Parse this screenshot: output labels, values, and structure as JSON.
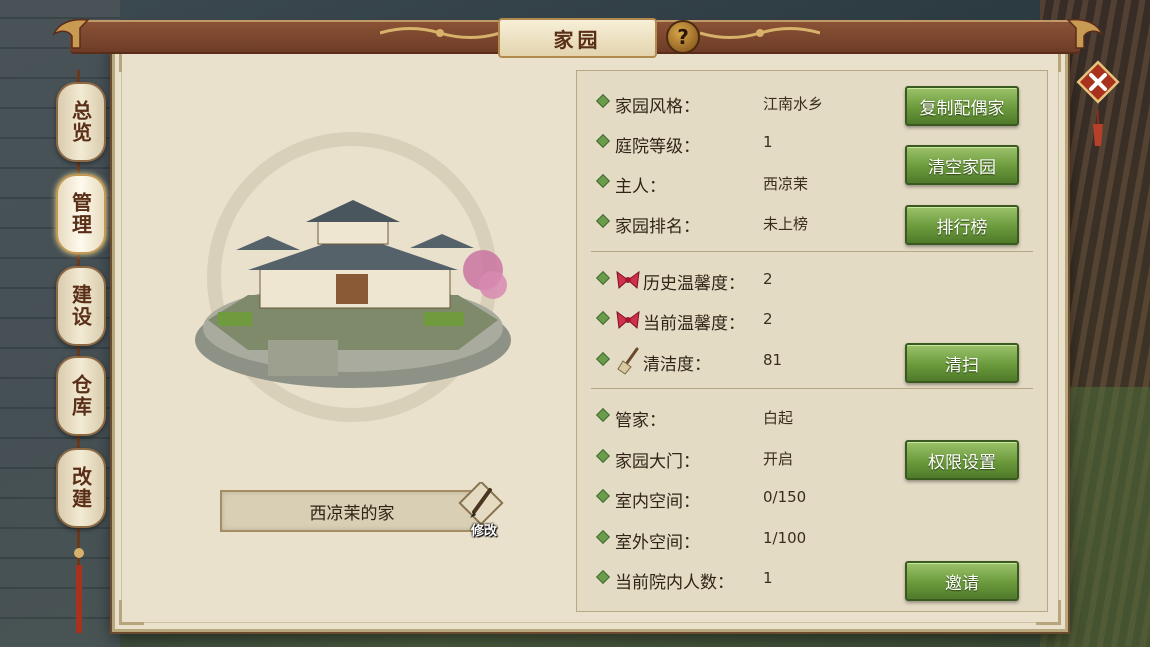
{
  "title": "家园",
  "help_icon": "?",
  "close_icon": "close-icon",
  "side_tabs": [
    {
      "label": "总览",
      "active": false
    },
    {
      "label": "管理",
      "active": true
    },
    {
      "label": "建设",
      "active": false
    },
    {
      "label": "仓库",
      "active": false
    },
    {
      "label": "改建",
      "active": false
    }
  ],
  "home_name": "西凉茉的家",
  "edit_label": "修改",
  "info": {
    "style": {
      "label": "家园风格：",
      "value": "江南水乡",
      "button": "复制配偶家"
    },
    "courtyard_level": {
      "label": "庭院等级：",
      "value": "1",
      "button": "清空家园"
    },
    "owner": {
      "label": "主人：",
      "value": "西凉茉"
    },
    "rank": {
      "label": "家园排名：",
      "value": "未上榜",
      "button": "排行榜"
    },
    "history_warmth": {
      "label": "历史温馨度：",
      "value": "2"
    },
    "current_warmth": {
      "label": "当前温馨度：",
      "value": "2"
    },
    "cleanliness": {
      "label": "清洁度：",
      "value": "81",
      "button": "清扫"
    },
    "steward": {
      "label": "管家：",
      "value": "白起"
    },
    "gate": {
      "label": "家园大门：",
      "value": "开启",
      "button": "权限设置"
    },
    "indoor_space": {
      "label": "室内空间：",
      "value": "0/150"
    },
    "outdoor_space": {
      "label": "室外空间：",
      "value": "1/100"
    },
    "visitors": {
      "label": "当前院内人数：",
      "value": "1",
      "button": "邀请"
    }
  },
  "colors": {
    "accent_green": "#6b9a3c",
    "title_bar": "#7a4530",
    "panel": "#e9e1cc"
  }
}
